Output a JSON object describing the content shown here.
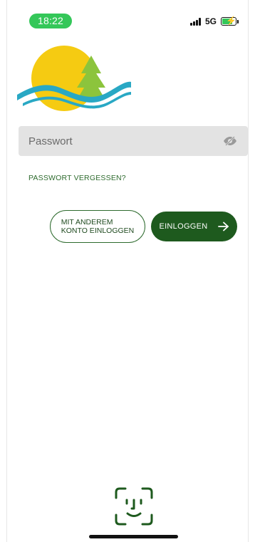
{
  "status_bar": {
    "time": "18:22",
    "network": "5G",
    "signal_bars": 4,
    "battery_level": 0.7,
    "battery_charging": true,
    "time_pill_color": "#34c759"
  },
  "logo": {
    "icon": "sun-tree-wave-logo",
    "colors": {
      "sun": "#f5cb12",
      "tree": "#8cc43c",
      "wave": "#29a8c4"
    }
  },
  "login_form": {
    "password": {
      "placeholder": "Passwort",
      "value": "",
      "visibility_icon": "eye-slash-icon"
    },
    "forgot_link_label": "PASSWORT VERGESSEN?",
    "alt_account_label": "MIT ANDEREM\nKONTO EINLOGGEN",
    "login_label": "EINLOGGEN",
    "login_icon": "arrow-right-icon"
  },
  "biometric": {
    "icon": "face-id-icon"
  },
  "colors": {
    "accent": "#1e5a1e",
    "link": "#2e6b2e",
    "field_background": "#e3e3e3"
  }
}
